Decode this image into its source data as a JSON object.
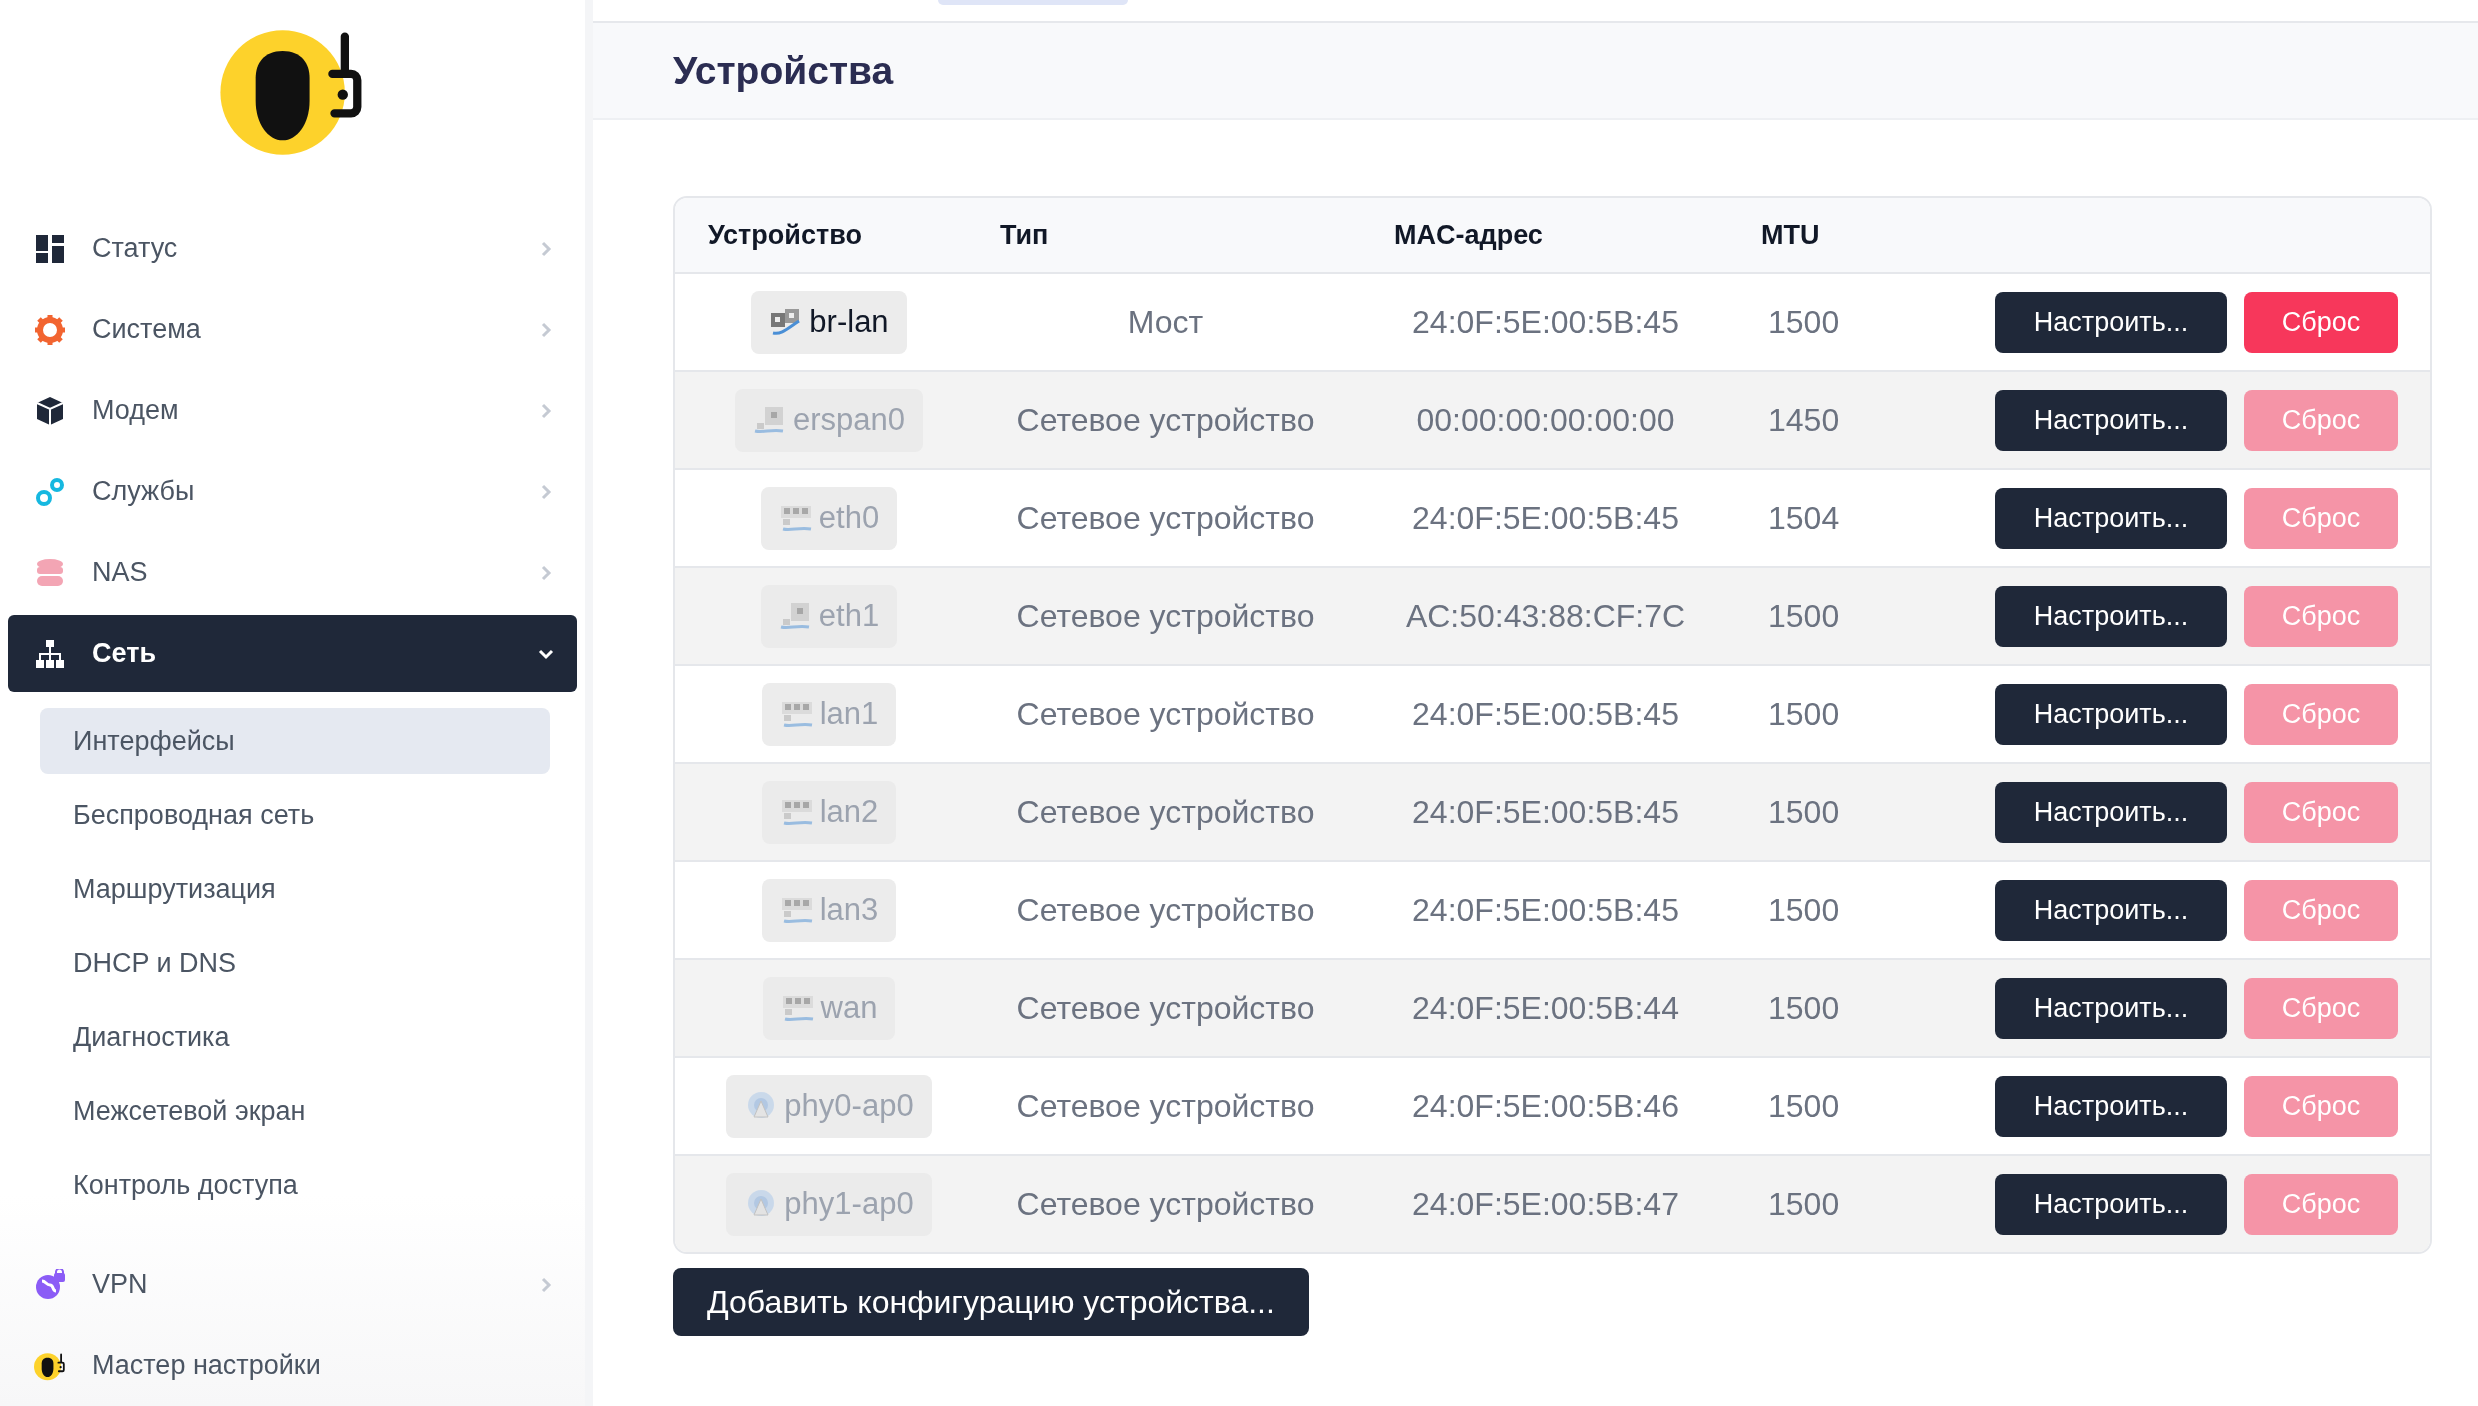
{
  "sidebar": {
    "items": [
      {
        "label": "Статус",
        "kind": "menu",
        "selected": false,
        "expanded": false
      },
      {
        "label": "Система",
        "kind": "menu",
        "selected": false,
        "expanded": false
      },
      {
        "label": "Модем",
        "kind": "menu",
        "selected": false,
        "expanded": false
      },
      {
        "label": "Службы",
        "kind": "menu",
        "selected": false,
        "expanded": false
      },
      {
        "label": "NAS",
        "kind": "menu",
        "selected": false,
        "expanded": false
      },
      {
        "label": "Сеть",
        "kind": "menu",
        "selected": true,
        "expanded": true,
        "children": [
          {
            "label": "Интерфейсы",
            "selected": true
          },
          {
            "label": "Беспроводная сеть",
            "selected": false
          },
          {
            "label": "Маршрутизация",
            "selected": false
          },
          {
            "label": "DHCP и DNS",
            "selected": false
          },
          {
            "label": "Диагностика",
            "selected": false
          },
          {
            "label": "Межсетевой экран",
            "selected": false
          },
          {
            "label": "Контроль доступа",
            "selected": false
          }
        ]
      },
      {
        "label": "VPN",
        "kind": "menu",
        "selected": false,
        "expanded": false
      },
      {
        "label": "Мастер настройки",
        "kind": "link",
        "selected": false
      }
    ]
  },
  "page": {
    "title": "Устройства"
  },
  "table": {
    "columns": [
      "Устройство",
      "Тип",
      "MAC-адрес",
      "MTU"
    ],
    "rows": [
      {
        "device": "br-lan",
        "kind": "bridge",
        "active": true,
        "type": "Мост",
        "mac": "24:0F:5E:00:5B:45",
        "mtu": "1500",
        "configure": "Настроить...",
        "reset": "Сброс"
      },
      {
        "device": "erspan0",
        "kind": "port",
        "active": false,
        "type": "Сетевое устройство",
        "mac": "00:00:00:00:00:00",
        "mtu": "1450",
        "configure": "Настроить...",
        "reset": "Сброс"
      },
      {
        "device": "eth0",
        "kind": "switch",
        "active": false,
        "type": "Сетевое устройство",
        "mac": "24:0F:5E:00:5B:45",
        "mtu": "1504",
        "configure": "Настроить...",
        "reset": "Сброс"
      },
      {
        "device": "eth1",
        "kind": "port",
        "active": false,
        "type": "Сетевое устройство",
        "mac": "AC:50:43:88:CF:7C",
        "mtu": "1500",
        "configure": "Настроить...",
        "reset": "Сброс"
      },
      {
        "device": "lan1",
        "kind": "switch",
        "active": false,
        "type": "Сетевое устройство",
        "mac": "24:0F:5E:00:5B:45",
        "mtu": "1500",
        "configure": "Настроить...",
        "reset": "Сброс"
      },
      {
        "device": "lan2",
        "kind": "switch",
        "active": false,
        "type": "Сетевое устройство",
        "mac": "24:0F:5E:00:5B:45",
        "mtu": "1500",
        "configure": "Настроить...",
        "reset": "Сброс"
      },
      {
        "device": "lan3",
        "kind": "switch",
        "active": false,
        "type": "Сетевое устройство",
        "mac": "24:0F:5E:00:5B:45",
        "mtu": "1500",
        "configure": "Настроить...",
        "reset": "Сброс"
      },
      {
        "device": "wan",
        "kind": "switch",
        "active": false,
        "type": "Сетевое устройство",
        "mac": "24:0F:5E:00:5B:44",
        "mtu": "1500",
        "configure": "Настроить...",
        "reset": "Сброс"
      },
      {
        "device": "phy0-ap0",
        "kind": "wireless",
        "active": false,
        "type": "Сетевое устройство",
        "mac": "24:0F:5E:00:5B:46",
        "mtu": "1500",
        "configure": "Настроить...",
        "reset": "Сброс"
      },
      {
        "device": "phy1-ap0",
        "kind": "wireless",
        "active": false,
        "type": "Сетевое устройство",
        "mac": "24:0F:5E:00:5B:47",
        "mtu": "1500",
        "configure": "Настроить...",
        "reset": "Сброс"
      }
    ]
  },
  "add_button": "Добавить конфигурацию устройства..."
}
